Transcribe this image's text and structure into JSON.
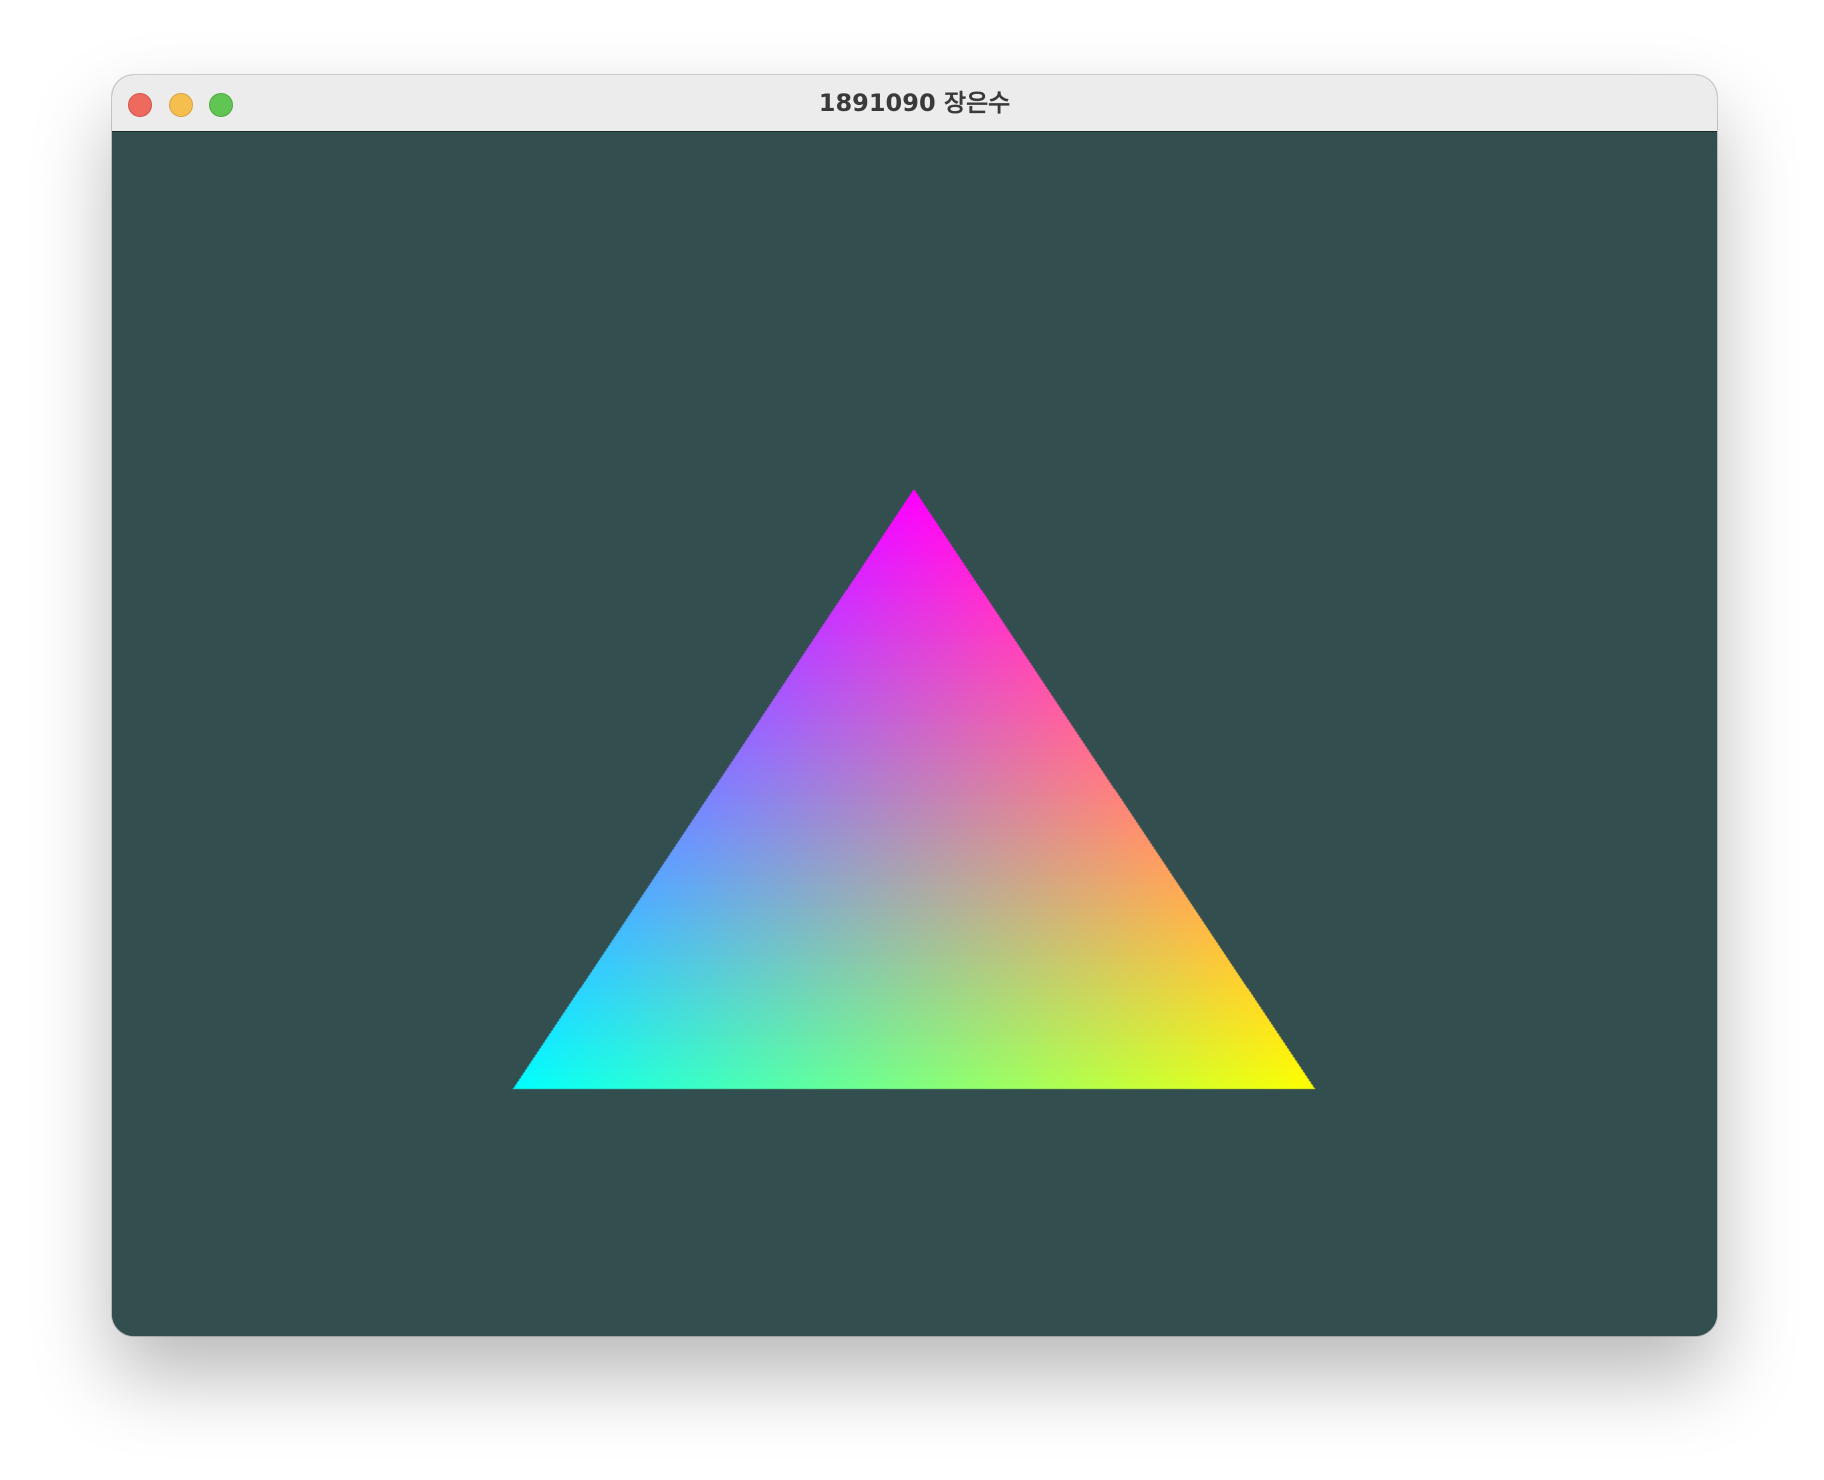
{
  "window": {
    "title": "1891090 장은수",
    "controls": {
      "close": "close-button",
      "minimize": "minimize-button",
      "zoom": "zoom-button"
    },
    "colors": {
      "titlebar": "#ececec",
      "clear_color": "#334e4f",
      "close": "#ee6a5f",
      "minimize": "#f5bf4f",
      "zoom": "#61c554"
    }
  },
  "scene": {
    "shape": "triangle",
    "vertex_colors": {
      "top": "#ff00ff",
      "bottom_left": "#00ffff",
      "bottom_right": "#ffff00"
    }
  }
}
